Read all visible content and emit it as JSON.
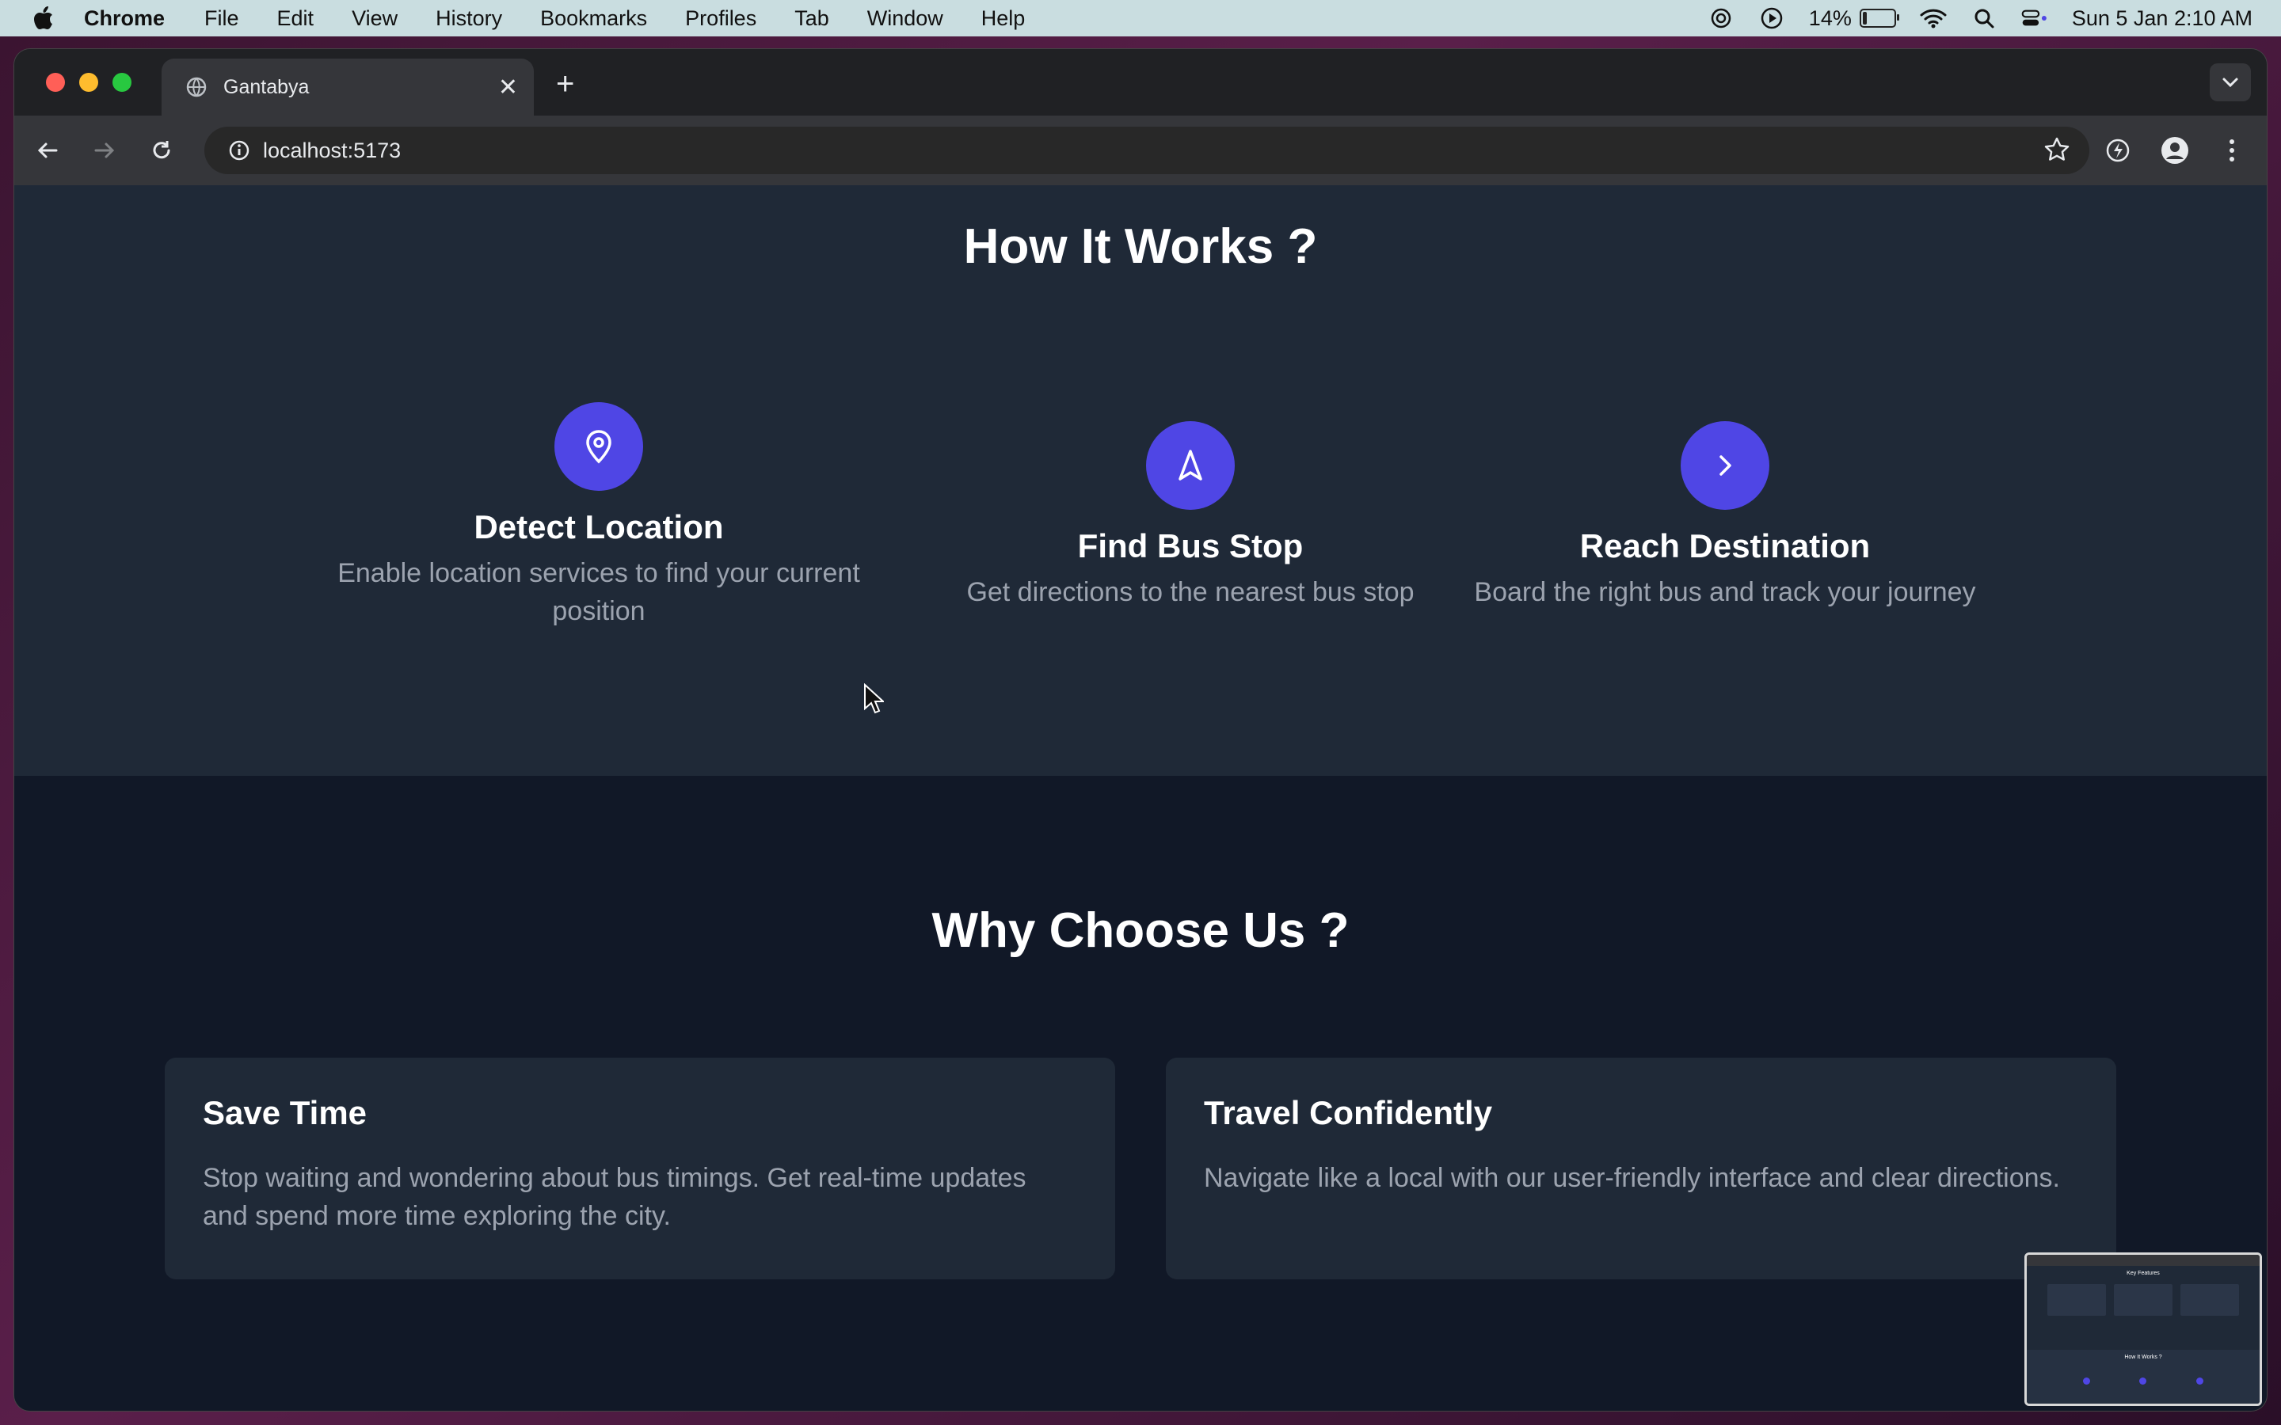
{
  "menubar": {
    "app": "Chrome",
    "items": [
      "File",
      "Edit",
      "View",
      "History",
      "Bookmarks",
      "Profiles",
      "Tab",
      "Window",
      "Help"
    ],
    "battery": "14%",
    "battery_level": 0.14,
    "datetime": "Sun 5 Jan  2:10 AM"
  },
  "browser": {
    "tab_title": "Gantabya",
    "url": "localhost:5173"
  },
  "how_it_works": {
    "heading": "How It Works ?",
    "steps": [
      {
        "icon": "map-pin-icon",
        "title": "Detect Location",
        "desc": "Enable location services to find your current position"
      },
      {
        "icon": "navigation-arrow-icon",
        "title": "Find Bus Stop",
        "desc": "Get directions to the nearest bus stop"
      },
      {
        "icon": "chevron-right-icon",
        "title": "Reach Destination",
        "desc": "Board the right bus and track your journey"
      }
    ]
  },
  "why_choose_us": {
    "heading": "Why Choose Us ?",
    "cards": [
      {
        "title": "Save Time",
        "desc": "Stop waiting and wondering about bus timings. Get real-time updates and spend more time exploring the city."
      },
      {
        "title": "Travel Confidently",
        "desc": "Navigate like a local with our user-friendly interface and clear directions."
      }
    ]
  },
  "thumbnail": {
    "title_top": "Key Features",
    "title_bottom": "How It Works ?"
  },
  "colors": {
    "accent": "#4f46e5",
    "section_dark": "#111827",
    "section_mid": "#1f2937",
    "muted_text": "#9ca3af"
  }
}
